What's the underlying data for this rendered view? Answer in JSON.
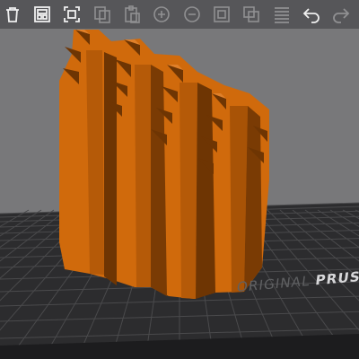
{
  "colors": {
    "background": "#78787a",
    "bed": "#2c2c2e",
    "bed_grid": "#4a4a4c",
    "model_light": "#d06a0c",
    "model_mid": "#b55a08",
    "model_dark": "#6e3503",
    "toolbar_icon": "#f0f0f0"
  },
  "toolbar": {
    "buttons": [
      {
        "name": "delete-all",
        "icon": "trash-icon",
        "enabled": true
      },
      {
        "name": "arrange",
        "icon": "arrange-icon",
        "enabled": true
      },
      {
        "name": "split",
        "icon": "split-icon",
        "enabled": true
      },
      {
        "name": "copy",
        "icon": "copy-icon",
        "enabled": false
      },
      {
        "name": "paste",
        "icon": "paste-icon",
        "enabled": false
      },
      {
        "name": "add-instance",
        "icon": "add-instance-icon",
        "enabled": false
      },
      {
        "name": "remove-instance",
        "icon": "remove-instance-icon",
        "enabled": false
      },
      {
        "name": "split-to-objects",
        "icon": "split-objects-icon",
        "enabled": false
      },
      {
        "name": "split-to-parts",
        "icon": "split-parts-icon",
        "enabled": false
      },
      {
        "name": "layers-editing",
        "icon": "layers-icon",
        "enabled": false
      },
      {
        "name": "undo",
        "icon": "undo-icon",
        "enabled": true
      },
      {
        "name": "redo",
        "icon": "redo-icon",
        "enabled": false
      }
    ]
  },
  "bed": {
    "label_light": "ORIGINAL ",
    "label_brand": "PRUSA"
  }
}
